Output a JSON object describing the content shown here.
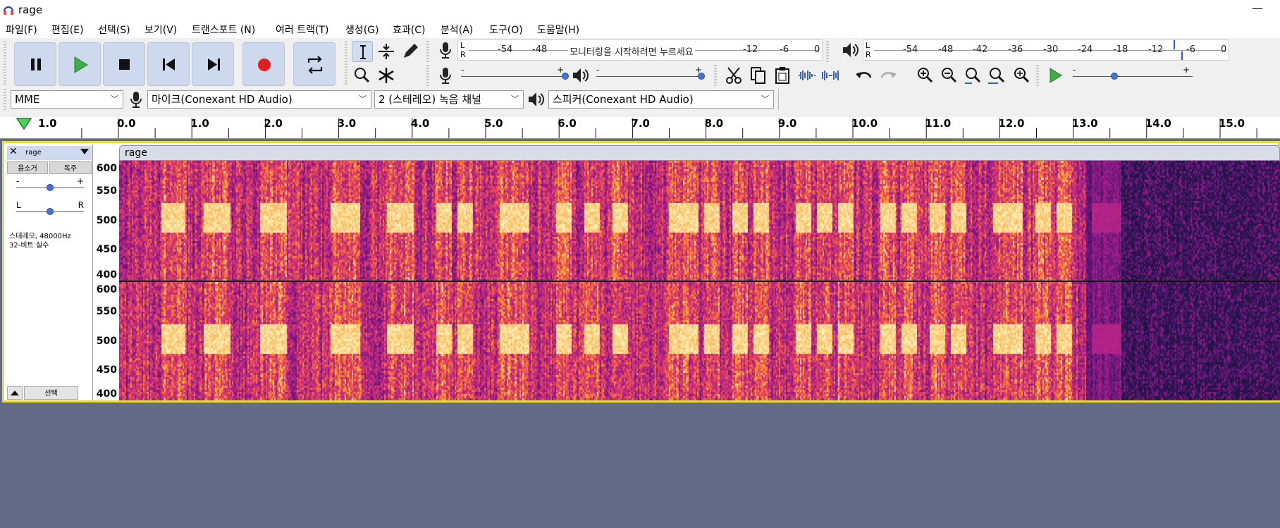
{
  "window": {
    "title": "rage"
  },
  "menu": [
    "파일(F)",
    "편집(E)",
    "선택(S)",
    "보기(V)",
    "트랜스포트 (N)",
    "여러 트랙(T)",
    "생성(G)",
    "효과(C)",
    "분석(A)",
    "도구(O)",
    "도움말(H)"
  ],
  "transport": {
    "buttons": [
      "pause-icon",
      "play-icon",
      "stop-icon",
      "skip-start-icon",
      "skip-end-icon",
      "record-icon",
      "loop-icon"
    ]
  },
  "record_meter": {
    "l": "L",
    "r": "R",
    "ticks": [
      "-54",
      "-48",
      "-12",
      "-6",
      "0"
    ],
    "prompt": "모니터링을 시작하려면 누르세요"
  },
  "play_meter": {
    "l": "L",
    "r": "R",
    "ticks": [
      "-54",
      "-48",
      "-42",
      "-36",
      "-30",
      "-24",
      "-18",
      "-12",
      "-6",
      "0"
    ]
  },
  "sliders": {
    "minus": "-",
    "plus": "+"
  },
  "device": {
    "host": "MME",
    "input": "마이크(Conexant HD Audio)",
    "channels": "2 (스테레오) 녹음 채널",
    "output": "스피커(Conexant HD Audio)"
  },
  "ruler": {
    "lead": "1.0",
    "ticks": [
      "0.0",
      "1.0",
      "2.0",
      "3.0",
      "4.0",
      "5.0",
      "6.0",
      "7.0",
      "8.0",
      "9.0",
      "10.0",
      "11.0",
      "12.0",
      "13.0",
      "14.0",
      "15.0"
    ]
  },
  "track": {
    "name": "rage",
    "mute": "음소거",
    "solo": "독주",
    "gain_minus": "-",
    "gain_plus": "+",
    "pan_l": "L",
    "pan_r": "R",
    "info1": "스테레오, 48000Hz",
    "info2": "32-비트 실수",
    "select": "선택",
    "clip_name": "rage",
    "scale_labels": [
      "600",
      "550",
      "500",
      "450",
      "400"
    ]
  },
  "colors": {
    "accent": "#4a6fd8",
    "track_border": "#e3e03a",
    "background": "#636b87",
    "record": "#e02020",
    "play": "#3fae49"
  }
}
